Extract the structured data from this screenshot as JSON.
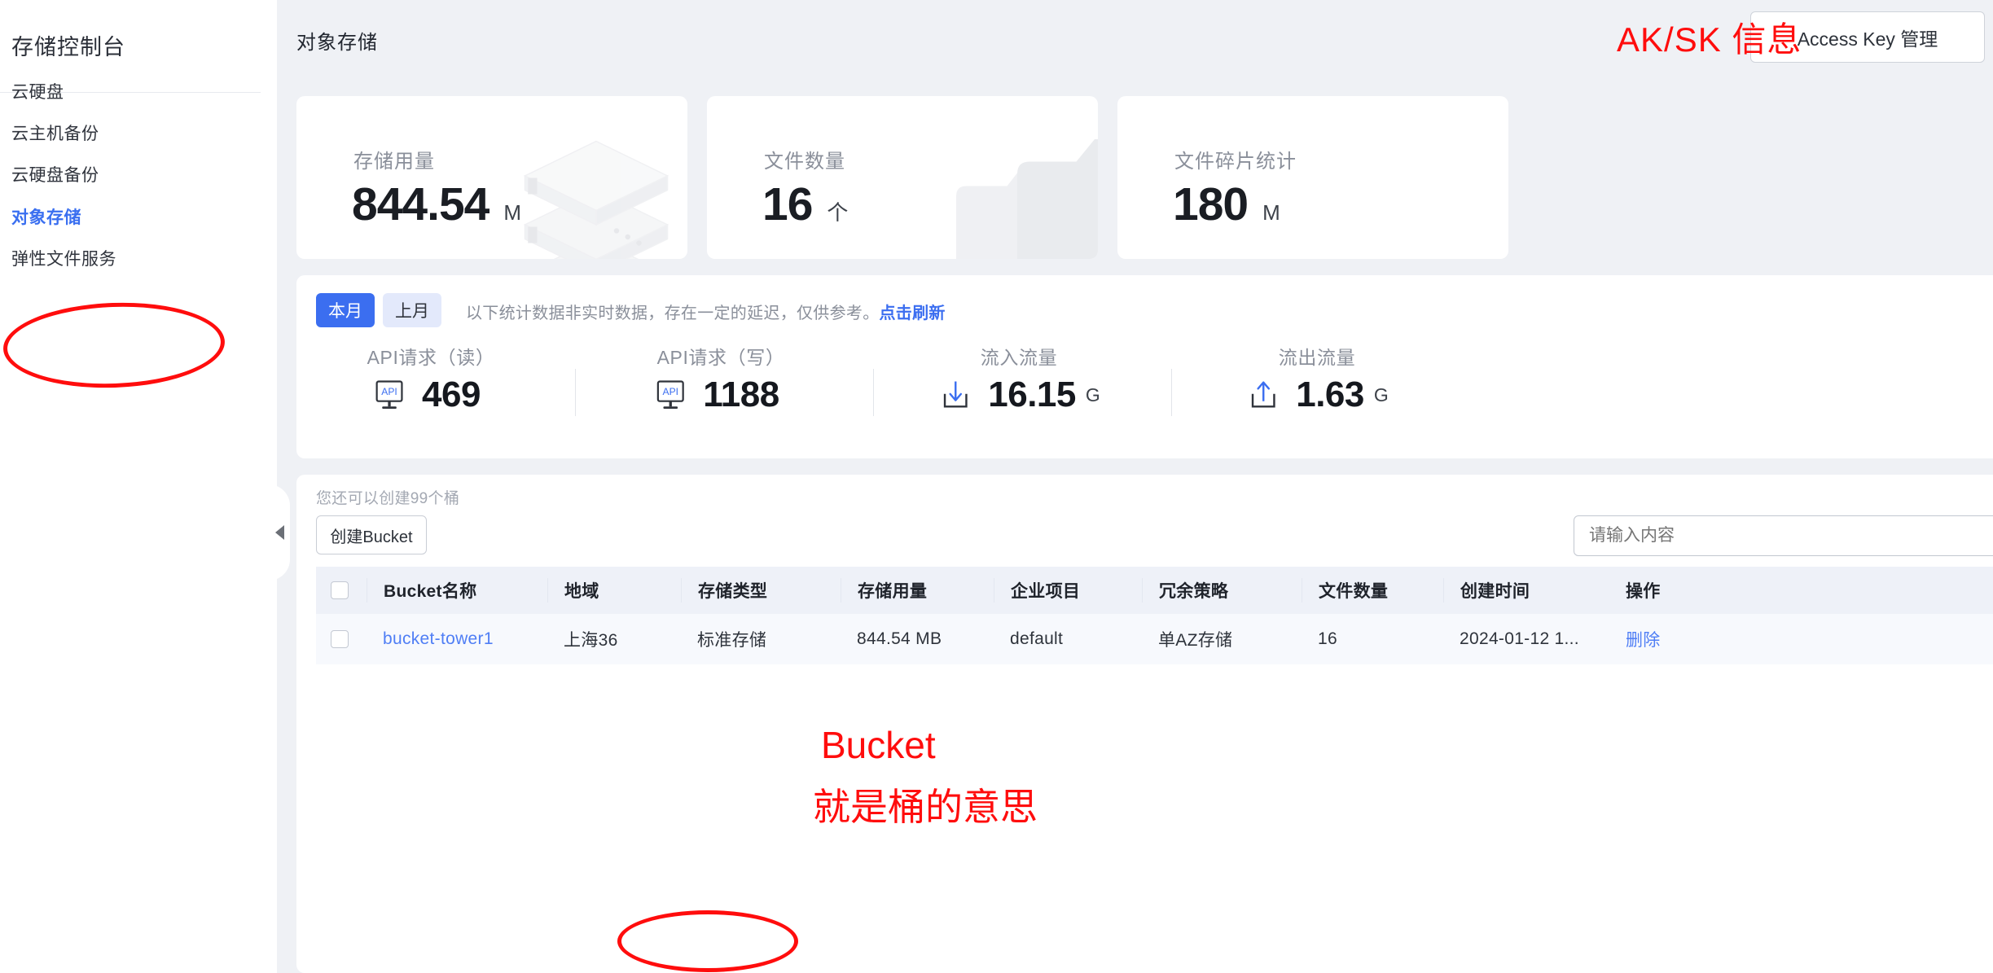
{
  "sidebar": {
    "title": "存储控制台",
    "items": [
      {
        "label": "云硬盘",
        "active": false
      },
      {
        "label": "云主机备份",
        "active": false
      },
      {
        "label": "云硬盘备份",
        "active": false
      },
      {
        "label": "对象存储",
        "active": true
      },
      {
        "label": "弹性文件服务",
        "active": false
      }
    ],
    "collapse_icon": "chevron-left-icon"
  },
  "header": {
    "page_title": "对象存储",
    "access_key_button": "Access Key 管理"
  },
  "stat_cards": [
    {
      "label": "存储用量",
      "value": "844.54",
      "unit": "M",
      "watermark": "server-stack-illustration"
    },
    {
      "label": "文件数量",
      "value": "16",
      "unit": "个",
      "watermark": "folder-illustration"
    },
    {
      "label": "文件碎片统计",
      "value": "180",
      "unit": "M",
      "watermark": ""
    }
  ],
  "stats_panel": {
    "tab_current": "本月",
    "tab_last": "上月",
    "note_text": "以下统计数据非实时数据，存在一定的延迟，仅供参考。",
    "note_link": "点击刷新",
    "metrics": [
      {
        "label": "API请求（读）",
        "value": "469",
        "unit": "",
        "icon": "api-monitor-icon"
      },
      {
        "label": "API请求（写）",
        "value": "1188",
        "unit": "",
        "icon": "api-monitor-icon"
      },
      {
        "label": "流入流量",
        "value": "16.15",
        "unit": "G",
        "icon": "download-tray-icon"
      },
      {
        "label": "流出流量",
        "value": "1.63",
        "unit": "G",
        "icon": "upload-tray-icon"
      }
    ]
  },
  "bucket_panel": {
    "quota_text": "您还可以创建99个桶",
    "create_button": "创建Bucket",
    "search_placeholder": "请输入内容",
    "table": {
      "columns": [
        "Bucket名称",
        "地域",
        "存储类型",
        "存储用量",
        "企业项目",
        "冗余策略",
        "文件数量",
        "创建时间",
        "操作"
      ],
      "rows": [
        {
          "name": "bucket-tower1",
          "region": "上海36",
          "storage_type": "标准存储",
          "storage_used": "844.54 MB",
          "project": "default",
          "redundancy": "单AZ存储",
          "file_count": "16",
          "created": "2024-01-12 1...",
          "action": "删除"
        }
      ]
    }
  },
  "annotations": {
    "aksk": "AK/SK 信息",
    "bucket_line1": "Bucket",
    "bucket_line2": "就是桶的意思",
    "color": "#ff0d0d"
  }
}
